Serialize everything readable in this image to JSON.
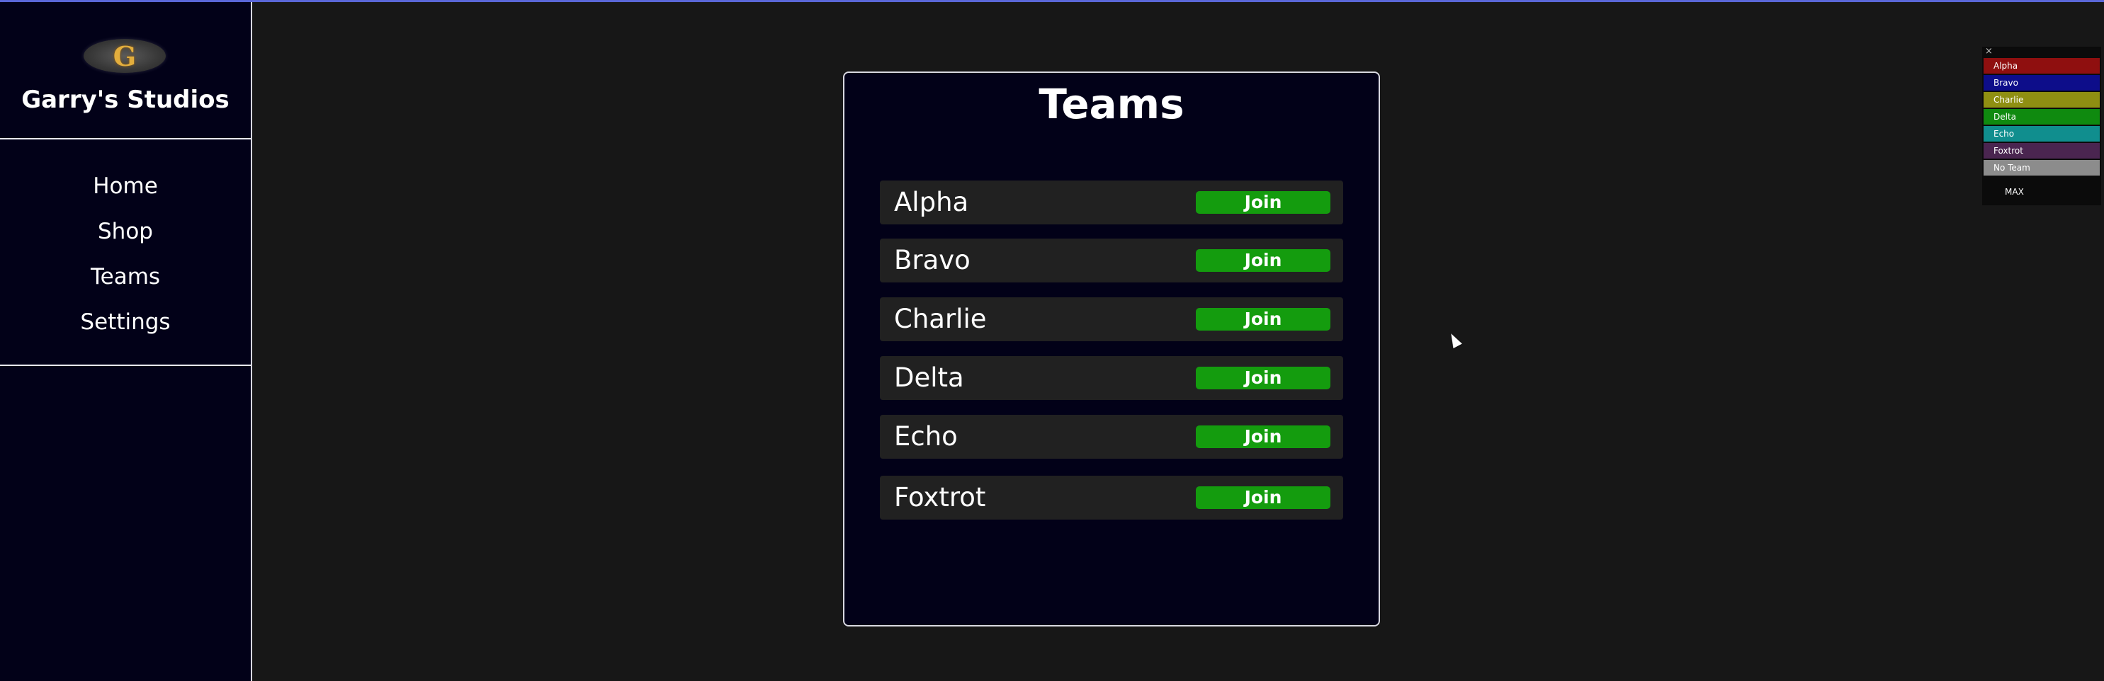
{
  "sidebar": {
    "logo_letter": "G",
    "title": "Garry's Studios",
    "nav": [
      "Home",
      "Shop",
      "Teams",
      "Settings"
    ]
  },
  "panel": {
    "title": "Teams",
    "join_label": "Join",
    "teams": [
      "Alpha",
      "Bravo",
      "Charlie",
      "Delta",
      "Echo",
      "Foxtrot"
    ]
  },
  "team_list": {
    "close": "×",
    "max": "MAX",
    "items": [
      {
        "label": "Alpha",
        "color": "#8f0f0f"
      },
      {
        "label": "Bravo",
        "color": "#0d0d8a"
      },
      {
        "label": "Charlie",
        "color": "#8f8f12"
      },
      {
        "label": "Delta",
        "color": "#0f8a0f"
      },
      {
        "label": "Echo",
        "color": "#108e8e"
      },
      {
        "label": "Foxtrot",
        "color": "#4a2550"
      },
      {
        "label": "No Team",
        "color": "#8c8c8c"
      }
    ]
  },
  "colors": {
    "background": "#171717",
    "panel": "#020118",
    "row": "#212121",
    "join": "#149c0e",
    "accent_line": "#5a67d8"
  }
}
